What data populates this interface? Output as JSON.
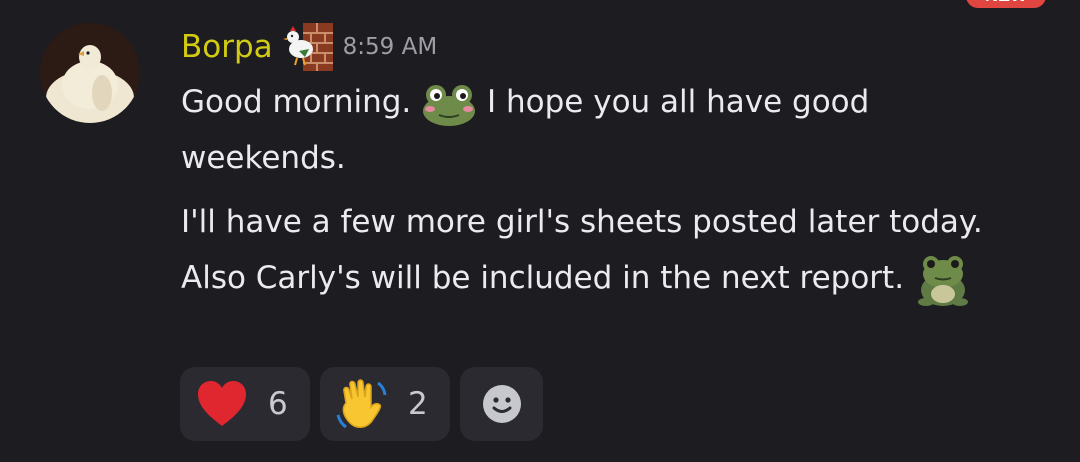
{
  "badge": {
    "label": "NEW"
  },
  "message": {
    "author": "Borpa",
    "author_color": "#d2cb14",
    "role_icon": "chicken-brick-wall-icon",
    "timestamp": "8:59 AM",
    "line1_part1": "Good morning.",
    "line1_emoji": "blushing-frog-emoji",
    "line1_part2": "I hope you all have good weekends.",
    "line2_text": "I'll have a few more girl's sheets posted later today. Also Carly's will be included in the next report.",
    "line2_emoji": "sitting-frog-emoji"
  },
  "reactions": [
    {
      "emoji": "red-heart-emoji",
      "count": "6"
    },
    {
      "emoji": "waving-hand-emoji",
      "count": "2"
    },
    {
      "emoji": "add-reaction-icon"
    }
  ],
  "colors": {
    "background": "#1d1c21",
    "text": "#ebeaef",
    "timestamp": "#9d9ea6",
    "reaction_bg": "#2b2a30",
    "badge": "#e0463f"
  }
}
